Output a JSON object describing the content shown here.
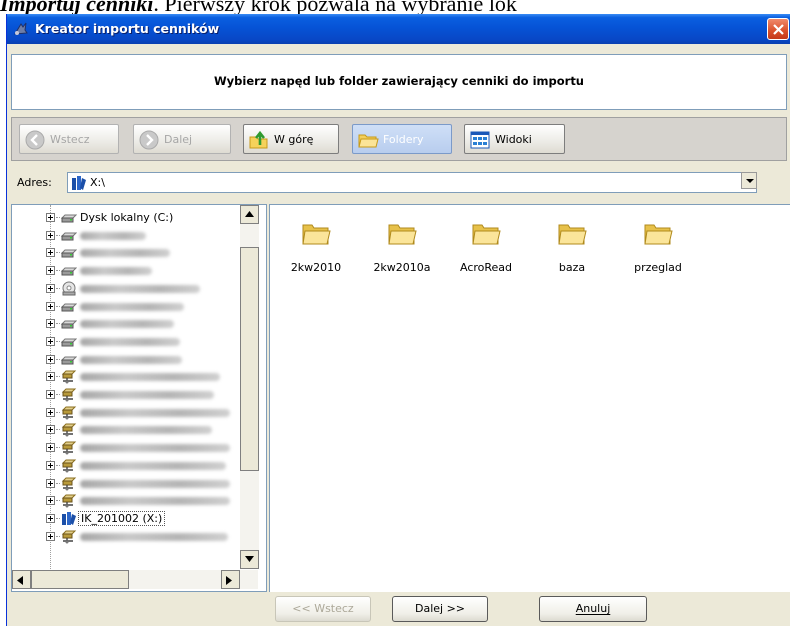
{
  "doc_header": {
    "bold_text": "Importuj cenniki",
    "rest_text": ". Pierwszy krok pozwala na wybranie lok"
  },
  "window": {
    "title": "Kreator importu cenników",
    "header_text": "Wybierz napęd lub folder zawierający cenniki do importu"
  },
  "toolbar": {
    "back_label": "Wstecz",
    "forward_label": "Dalej",
    "up_label": "W górę",
    "folders_label": "Foldery",
    "views_label": "Widoki"
  },
  "address": {
    "label": "Adres:",
    "value": "X:\\"
  },
  "tree": {
    "items": [
      {
        "label": "Dysk lokalny (C:)",
        "icon": "drive-icon",
        "blurred": false
      },
      {
        "label": "",
        "icon": "drive-icon",
        "blurred": true
      },
      {
        "label": "",
        "icon": "drive-icon",
        "blurred": true
      },
      {
        "label": "",
        "icon": "drive-icon",
        "blurred": true
      },
      {
        "label": "",
        "icon": "cd-drive-icon",
        "blurred": true
      },
      {
        "label": "",
        "icon": "drive-icon",
        "blurred": true
      },
      {
        "label": "",
        "icon": "drive-icon",
        "blurred": true
      },
      {
        "label": "",
        "icon": "drive-icon",
        "blurred": true
      },
      {
        "label": "",
        "icon": "drive-icon",
        "blurred": true
      },
      {
        "label": "",
        "icon": "network-drive-icon",
        "blurred": true
      },
      {
        "label": "",
        "icon": "network-drive-icon",
        "blurred": true
      },
      {
        "label": "",
        "icon": "network-drive-icon",
        "blurred": true
      },
      {
        "label": "",
        "icon": "network-drive-icon",
        "blurred": true
      },
      {
        "label": "",
        "icon": "network-drive-icon",
        "blurred": true
      },
      {
        "label": "",
        "icon": "network-drive-icon",
        "blurred": true
      },
      {
        "label": "",
        "icon": "network-drive-icon",
        "blurred": true
      },
      {
        "label": "",
        "icon": "network-drive-icon",
        "blurred": true
      },
      {
        "label": "IK_201002 (X:)",
        "icon": "library-icon",
        "blurred": false
      },
      {
        "label": "",
        "icon": "network-drive-icon",
        "blurred": true
      }
    ]
  },
  "files": [
    {
      "name": "2kw2010"
    },
    {
      "name": "2kw2010a"
    },
    {
      "name": "AcroRead"
    },
    {
      "name": "baza"
    },
    {
      "name": "przeglad"
    }
  ],
  "footer": {
    "back_label": "<< Wstecz",
    "next_label": "Dalej >>",
    "cancel_label": "Anuluj"
  }
}
